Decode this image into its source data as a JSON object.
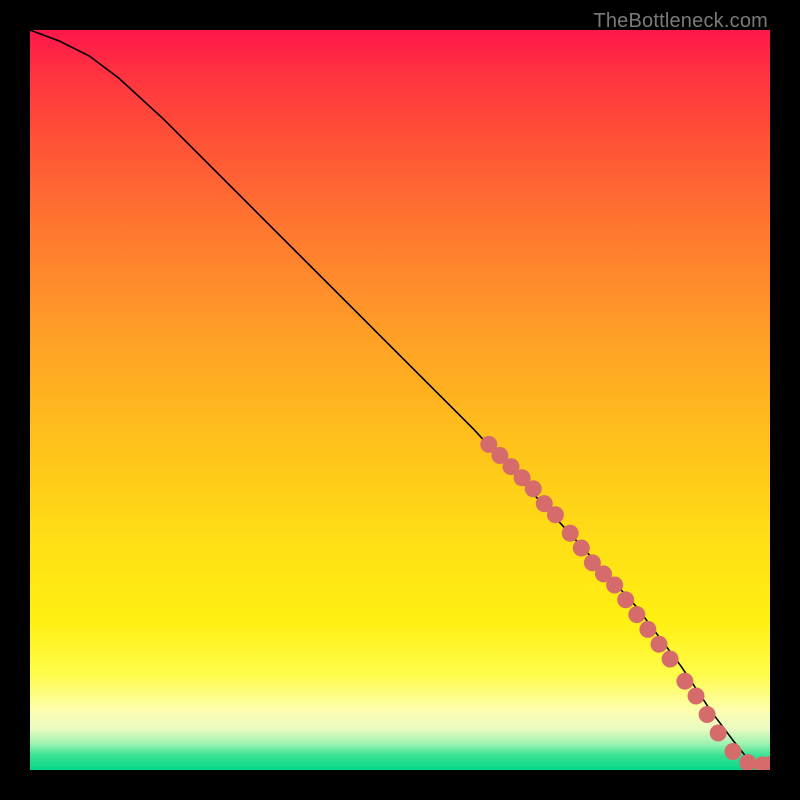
{
  "watermark": "TheBottleneck.com",
  "colors": {
    "marker": "#d66b6b",
    "curve": "#000000"
  },
  "chart_data": {
    "type": "line",
    "title": "",
    "xlabel": "",
    "ylabel": "",
    "xlim": [
      0,
      100
    ],
    "ylim": [
      0,
      100
    ],
    "grid": false,
    "series": [
      {
        "name": "curve",
        "x": [
          0,
          4,
          8,
          12,
          18,
          30,
          45,
          60,
          72,
          82,
          88,
          92,
          95,
          97,
          99,
          100
        ],
        "y": [
          100,
          98.5,
          96.5,
          93.5,
          88,
          76,
          61,
          46,
          33,
          22,
          14,
          8,
          4,
          1.5,
          0.5,
          0.5
        ]
      }
    ],
    "markers": [
      {
        "x": 62,
        "y": 44
      },
      {
        "x": 63.5,
        "y": 42.5
      },
      {
        "x": 65,
        "y": 41
      },
      {
        "x": 66.5,
        "y": 39.5
      },
      {
        "x": 68,
        "y": 38
      },
      {
        "x": 69.5,
        "y": 36
      },
      {
        "x": 71,
        "y": 34.5
      },
      {
        "x": 73,
        "y": 32
      },
      {
        "x": 74.5,
        "y": 30
      },
      {
        "x": 76,
        "y": 28
      },
      {
        "x": 77.5,
        "y": 26.5
      },
      {
        "x": 79,
        "y": 25
      },
      {
        "x": 80.5,
        "y": 23
      },
      {
        "x": 82,
        "y": 21
      },
      {
        "x": 83.5,
        "y": 19
      },
      {
        "x": 85,
        "y": 17
      },
      {
        "x": 86.5,
        "y": 15
      },
      {
        "x": 88.5,
        "y": 12
      },
      {
        "x": 90,
        "y": 10
      },
      {
        "x": 91.5,
        "y": 7.5
      },
      {
        "x": 93,
        "y": 5
      },
      {
        "x": 95,
        "y": 2.5
      },
      {
        "x": 97,
        "y": 1
      },
      {
        "x": 99,
        "y": 0.7
      },
      {
        "x": 100,
        "y": 0.7
      }
    ]
  }
}
